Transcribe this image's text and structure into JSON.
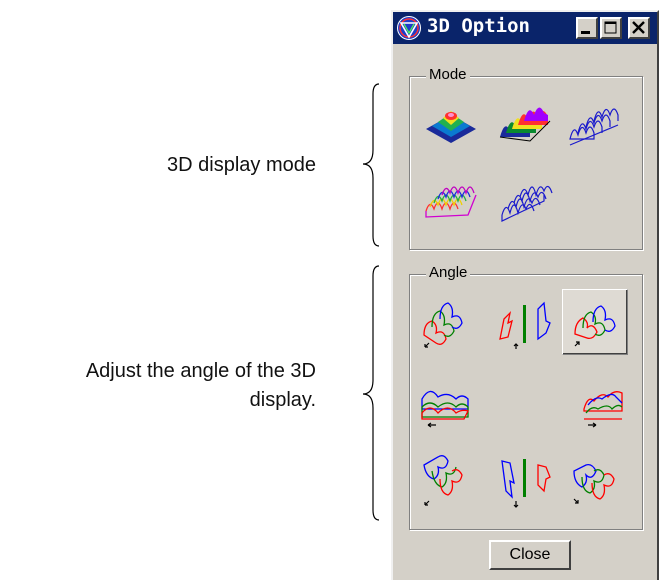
{
  "annotations": {
    "mode_text": "3D display mode",
    "angle_line1": "Adjust the angle of the 3D",
    "angle_line2": "display."
  },
  "window": {
    "title": "3D Option",
    "minimize_icon": "minimize-icon",
    "maximize_icon": "maximize-icon",
    "close_icon": "close-icon"
  },
  "mode_group": {
    "label": "Mode",
    "buttons": [
      "contour-map-mode",
      "color-waterfall-mode",
      "wireframe-waterfall-mode",
      "rainbow-wave-mode",
      "outline-wave-mode"
    ]
  },
  "angle_group": {
    "label": "Angle",
    "selected": "angle-top-right",
    "buttons": [
      "angle-top-left",
      "angle-top",
      "angle-top-right",
      "angle-left",
      "angle-right",
      "angle-bottom-left",
      "angle-bottom",
      "angle-bottom-right"
    ]
  },
  "close_button": {
    "label": "Close"
  },
  "colors": {
    "titlebar": "#0a246a",
    "face": "#d4d0c8",
    "series_red": "#ff0000",
    "series_green": "#008000",
    "series_blue": "#0000ff"
  }
}
